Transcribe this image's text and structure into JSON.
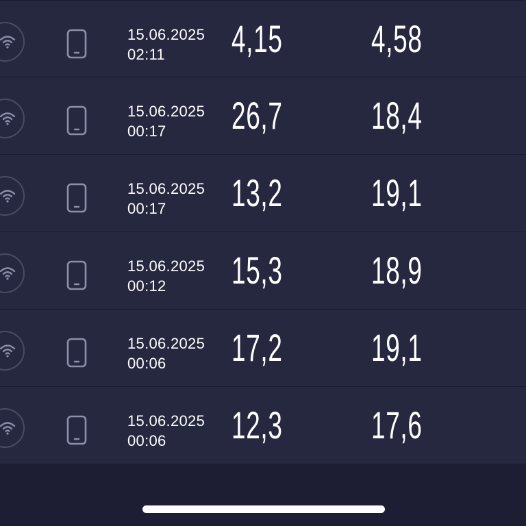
{
  "results": [
    {
      "date": "15.06.2025",
      "time": "02:11",
      "download": "4,15",
      "upload": "4,58"
    },
    {
      "date": "15.06.2025",
      "time": "00:17",
      "download": "26,7",
      "upload": "18,4"
    },
    {
      "date": "15.06.2025",
      "time": "00:17",
      "download": "13,2",
      "upload": "19,1"
    },
    {
      "date": "15.06.2025",
      "time": "00:12",
      "download": "15,3",
      "upload": "18,9"
    },
    {
      "date": "15.06.2025",
      "time": "00:06",
      "download": "17,2",
      "upload": "19,1"
    },
    {
      "date": "15.06.2025",
      "time": "00:06",
      "download": "12,3",
      "upload": "17,6"
    }
  ],
  "icons": {
    "connection": "wifi-icon",
    "device": "smartphone-icon"
  },
  "colors": {
    "background": "#1d1e33",
    "row_background": "#262840",
    "icon": "#8d8fa8",
    "text": "#ffffff"
  }
}
